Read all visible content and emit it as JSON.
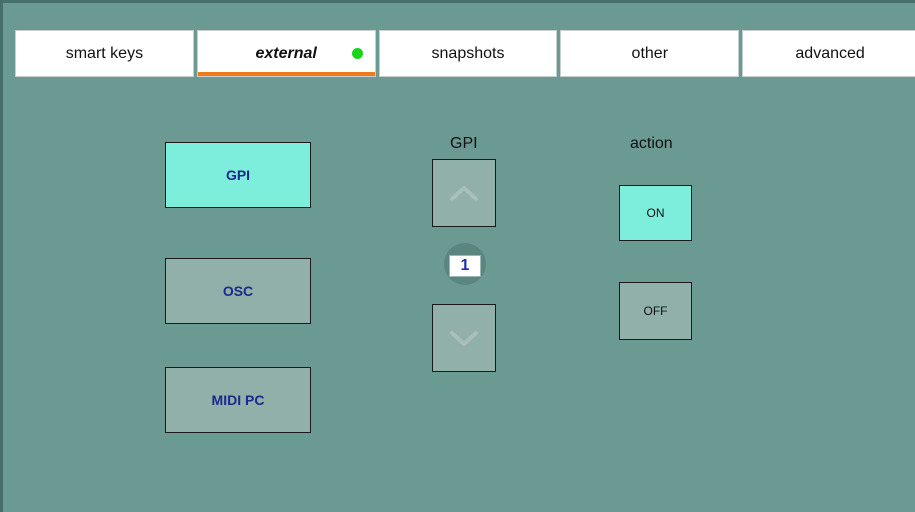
{
  "tabs": [
    {
      "label": "smart keys",
      "active": false
    },
    {
      "label": "external",
      "active": true,
      "indicator_color": "#19d419"
    },
    {
      "label": "snapshots",
      "active": false
    },
    {
      "label": "other",
      "active": false
    },
    {
      "label": "advanced",
      "active": false
    }
  ],
  "sources": {
    "gpi": {
      "label": "GPI",
      "active": true
    },
    "osc": {
      "label": "OSC",
      "active": false
    },
    "midi_pc": {
      "label": "MIDI PC",
      "active": false
    }
  },
  "gpi_selector": {
    "title": "GPI",
    "value": "1",
    "up_icon": "chevron-up-icon",
    "down_icon": "chevron-down-icon"
  },
  "action": {
    "title": "action",
    "on_label": "ON",
    "off_label": "OFF",
    "selected": "ON"
  },
  "colors": {
    "background": "#6b9a93",
    "active_button": "#7ceedb",
    "inactive_button": "#92b0aa",
    "tab_underline": "#f07a1a"
  }
}
